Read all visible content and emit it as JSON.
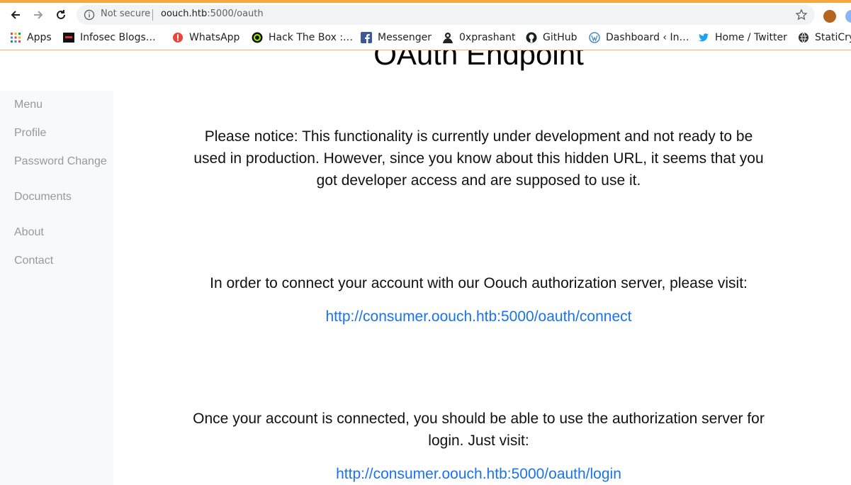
{
  "browser": {
    "not_secure": "Not secure",
    "url_host": "oouch.htb",
    "url_rest": ":5000/oauth",
    "bookmarks": [
      {
        "label": "Apps",
        "icon": "apps-grid-icon"
      },
      {
        "label": "Infosec Blogs…",
        "icon": "infosec-icon"
      },
      {
        "label": "WhatsApp",
        "icon": "whatsapp-icon"
      },
      {
        "label": "Hack The Box :…",
        "icon": "hackthebox-icon"
      },
      {
        "label": "Messenger",
        "icon": "facebook-icon"
      },
      {
        "label": "0xprashant",
        "icon": "avatar-icon"
      },
      {
        "label": "GitHub",
        "icon": "github-icon"
      },
      {
        "label": "Dashboard ‹ In…",
        "icon": "wordpress-icon"
      },
      {
        "label": "Home / Twitter",
        "icon": "twitter-icon"
      },
      {
        "label": "StatiCry",
        "icon": "globe-icon"
      }
    ]
  },
  "page": {
    "title": "OAuth Endpoint",
    "sidebar": [
      "Menu",
      "Profile",
      "Password Change",
      "Documents",
      "About",
      "Contact"
    ],
    "notice": "Please notice: This functionality is currently under development and not ready to be used in production. However, since you know about this hidden URL, it seems that you got developer access and are supposed to use it.",
    "connect_text": "In order to connect your account with our Oouch authorization server, please visit:",
    "connect_link": "http://consumer.oouch.htb:5000/oauth/connect",
    "login_text": "Once your account is connected, you should be able to use the authorization server for login. Just visit:",
    "login_link": "http://consumer.oouch.htb:5000/oauth/login"
  },
  "colors": {
    "accent_strip": "#f5a742",
    "link": "#1a73e8",
    "sidebar_bg": "#f8f9fa",
    "sidebar_text": "#999999"
  }
}
